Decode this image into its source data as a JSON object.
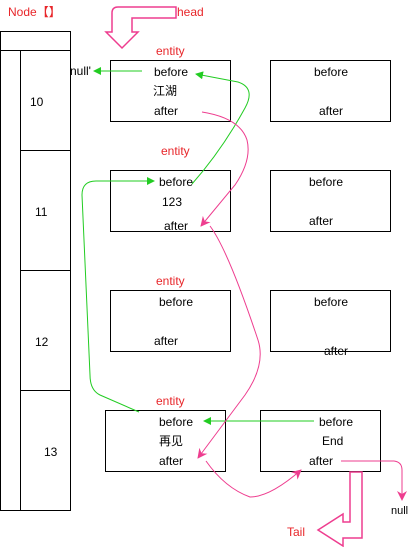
{
  "title": "Node【】",
  "head_label": "head",
  "tail_label": "Tail",
  "rows": [
    "10",
    "11",
    "12",
    "13"
  ],
  "entity_labels": [
    "entity",
    "entity",
    "entity",
    "entity"
  ],
  "null_left": "null'",
  "null_right": "null",
  "entities": {
    "r0c0": {
      "before": "before",
      "value": "江湖",
      "after": "after"
    },
    "r0c1": {
      "before": "before",
      "after": "after"
    },
    "r1c0": {
      "before": "before",
      "value": "123",
      "after": "after"
    },
    "r1c1": {
      "before": "before",
      "after": "after"
    },
    "r2c0": {
      "before": "before",
      "after": "after"
    },
    "r2c1": {
      "before": "before",
      "after": "after"
    },
    "r3c0": {
      "before": "before",
      "value": "再见",
      "after": "after"
    },
    "r3c1": {
      "before": "before",
      "value": "End",
      "after": "after"
    }
  },
  "colors": {
    "green": "#22cc22",
    "pink": "#ee3d8f",
    "red": "#e8262a",
    "line": "#000000"
  }
}
